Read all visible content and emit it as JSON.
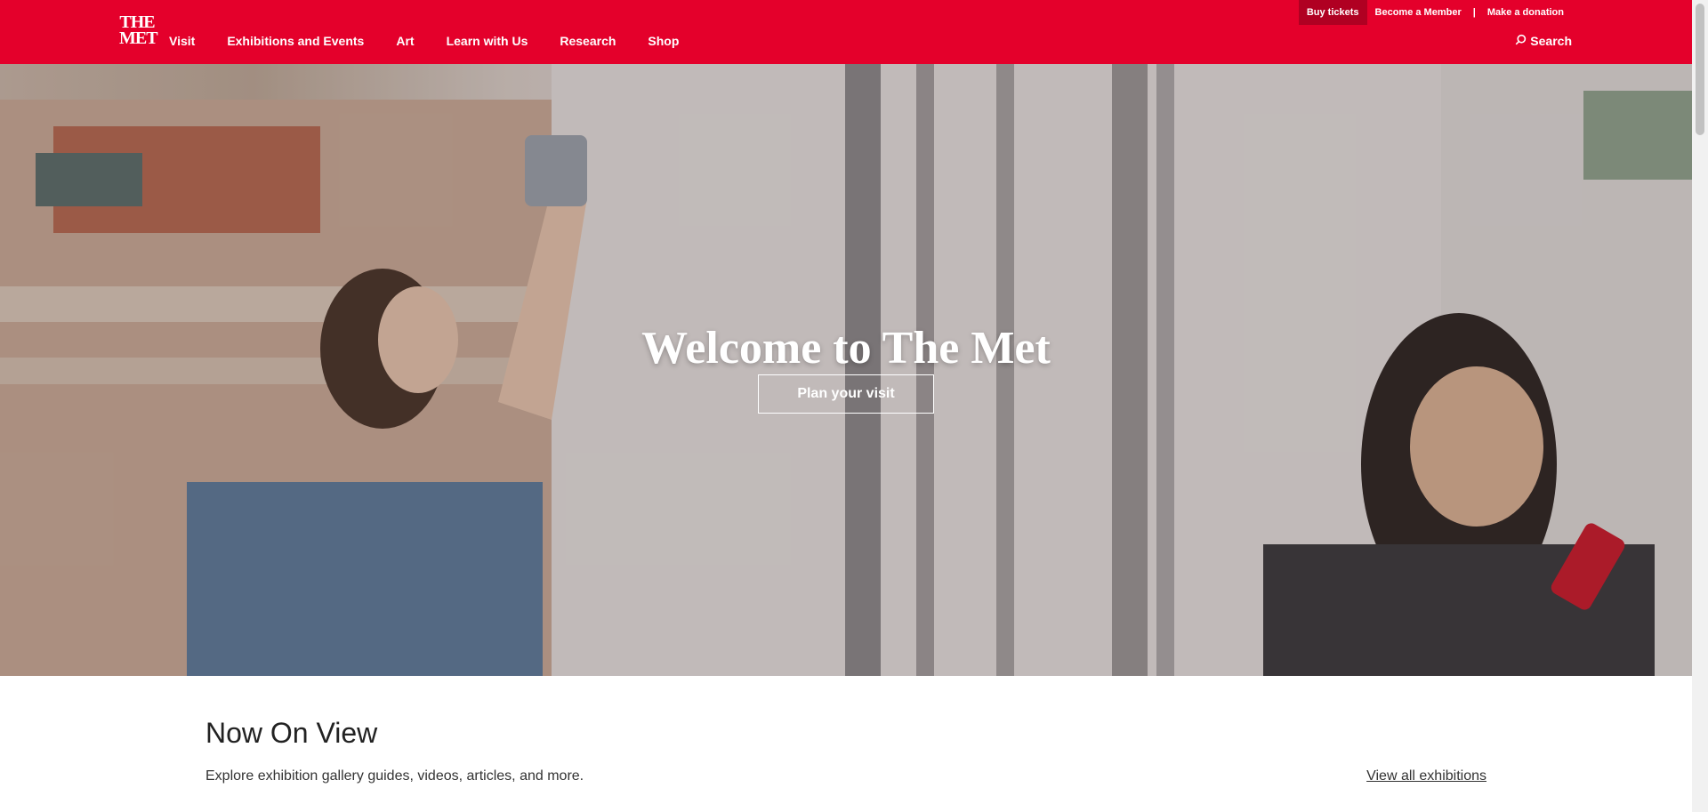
{
  "colors": {
    "brand": "#e4002b",
    "buy_button_bg": "#b00022"
  },
  "header": {
    "logo": {
      "line1": "THE",
      "line2": "MET"
    },
    "nav": [
      {
        "label": "Visit"
      },
      {
        "label": "Exhibitions and Events"
      },
      {
        "label": "Art"
      },
      {
        "label": "Learn with Us"
      },
      {
        "label": "Research"
      },
      {
        "label": "Shop"
      }
    ],
    "utility": {
      "buy_tickets": "Buy tickets",
      "become_member": "Become a Member",
      "separator": "|",
      "donation": "Make a donation"
    },
    "search": {
      "label": "Search",
      "icon": "search-icon"
    }
  },
  "hero": {
    "title": "Welcome to The Met",
    "cta": "Plan your visit"
  },
  "now_on_view": {
    "title": "Now On View",
    "description": "Explore exhibition gallery guides, videos, articles, and more.",
    "link": "View all exhibitions"
  }
}
